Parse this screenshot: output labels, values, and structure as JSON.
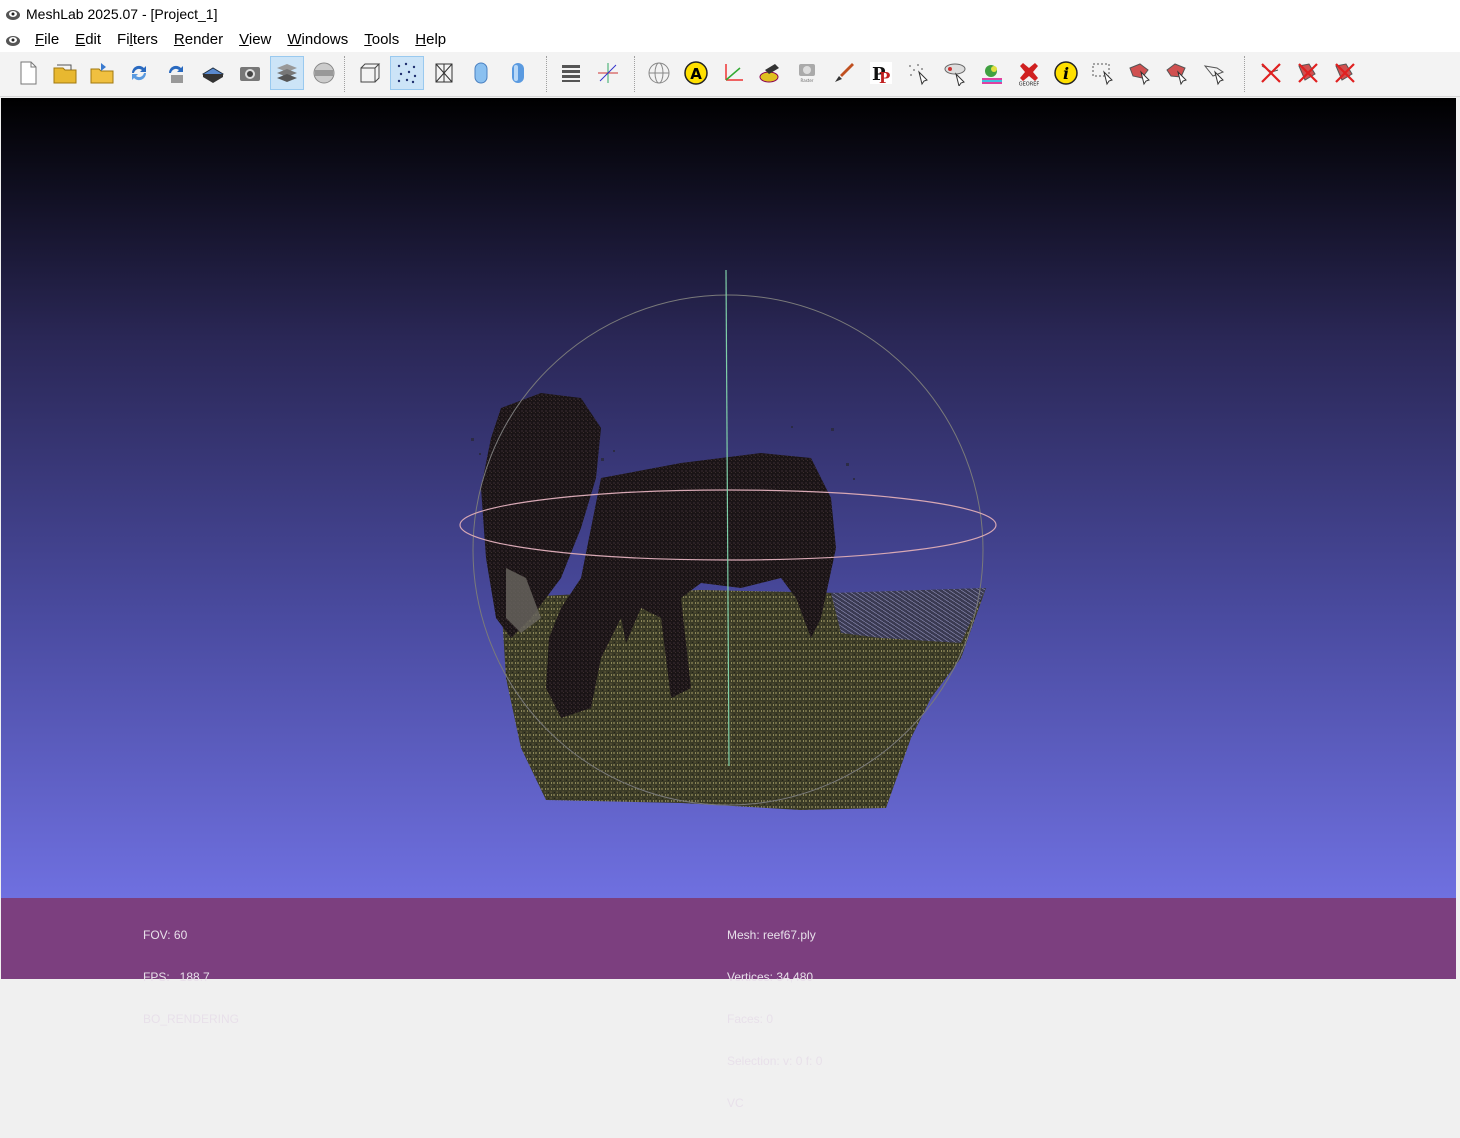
{
  "window": {
    "title": "MeshLab 2025.07 - [Project_1]"
  },
  "menu": {
    "items": [
      {
        "acc": "F",
        "rest": "ile"
      },
      {
        "acc": "E",
        "rest": "dit"
      },
      {
        "pre": "Fi",
        "acc": "l",
        "rest": "ters"
      },
      {
        "acc": "R",
        "rest": "ender"
      },
      {
        "acc": "V",
        "rest": "iew"
      },
      {
        "acc": "W",
        "rest": "indows"
      },
      {
        "acc": "T",
        "rest": "ools"
      },
      {
        "acc": "H",
        "rest": "elp"
      }
    ]
  },
  "toolbar": {
    "buttons": [
      {
        "name": "new-project-icon"
      },
      {
        "name": "open-project-icon"
      },
      {
        "name": "import-mesh-icon"
      },
      {
        "name": "reload-icon"
      },
      {
        "name": "reload-all-icon"
      },
      {
        "name": "export-mesh-icon"
      },
      {
        "name": "snapshot-icon"
      },
      {
        "name": "layers-icon",
        "active": true
      },
      {
        "name": "raster-icon"
      },
      {
        "name": "bbox-render-icon"
      },
      {
        "name": "points-render-icon",
        "active": true
      },
      {
        "name": "wireframe-render-icon"
      },
      {
        "name": "flat-render-icon"
      },
      {
        "name": "smooth-render-icon"
      },
      {
        "name": "texture-icon"
      },
      {
        "name": "axis-icon"
      },
      {
        "name": "align-globe-icon"
      },
      {
        "name": "annotation-icon",
        "text": "A"
      },
      {
        "name": "measure-axes-icon"
      },
      {
        "name": "scale-tool-icon"
      },
      {
        "name": "raster-alignment-icon",
        "text": "Raster\nAlignment"
      },
      {
        "name": "paint-icon"
      },
      {
        "name": "pick-points-icon",
        "text": "PP"
      },
      {
        "name": "select-vertices-icon"
      },
      {
        "name": "select-connected-icon"
      },
      {
        "name": "color-paint-icon"
      },
      {
        "name": "georef-icon",
        "text": "GEOREF"
      },
      {
        "name": "info-icon",
        "text": "i"
      },
      {
        "name": "select-rect-icon"
      },
      {
        "name": "select-faces-icon"
      },
      {
        "name": "select-faces-plus-icon"
      },
      {
        "name": "select-pointer-icon"
      },
      {
        "name": "delete-vertices-icon"
      },
      {
        "name": "delete-faces-icon"
      },
      {
        "name": "delete-faces-vertices-icon"
      }
    ]
  },
  "info": {
    "left": {
      "fov": "FOV: 60",
      "fps": "FPS:   188.7",
      "mode": "BO_RENDERING"
    },
    "right": {
      "mesh": "Mesh: reef67.ply",
      "vertices": "Vertices: 34,480",
      "faces": "Faces: 0",
      "selection": "Selection: v: 0 f: 0",
      "color": "VC"
    }
  },
  "colors": {
    "info_bg": "#7c3f7f",
    "active_button": "#cce4f7"
  }
}
